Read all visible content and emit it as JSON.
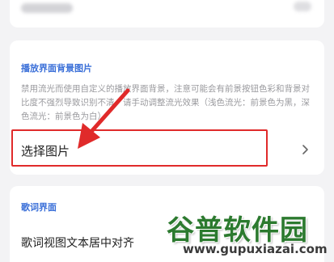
{
  "background_section": {
    "title": "播放界面背景图片",
    "description": "禁用流光而使用自定义的播放界面背景，注意可能会有前景按钮色彩和背景对比度不强烈导致识别不清，请手动调整流光效果（浅色流光：前景色为黑，深色流光：前景色为白）",
    "select_label": "选择图片",
    "chevron_icon": "chevron-right-icon"
  },
  "lyrics_section": {
    "title": "歌词界面",
    "row_label": "歌词视图文本居中对齐"
  },
  "watermark": {
    "name": "谷普软件园",
    "url": "www.gupuxiazai.com"
  },
  "colors": {
    "accent": "#3a6fd8",
    "highlight_box": "#e02a2a",
    "arrow": "#e02a2a"
  }
}
